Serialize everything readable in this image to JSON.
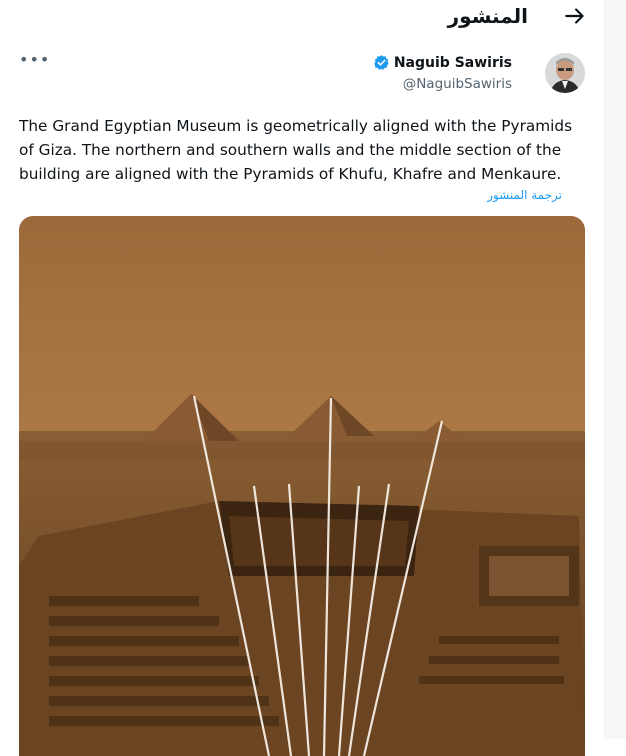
{
  "header": {
    "title": "المنشور"
  },
  "author": {
    "name": "Naguib Sawiris",
    "handle": "@NaguibSawiris"
  },
  "post": {
    "text": "The Grand Egyptian Museum is geometrically aligned with the Pyramids of Giza. The northern and southern walls and the middle section of the building are aligned with the Pyramids of Khufu, Khafre and Menkaure.",
    "translate_label": "ترجمة المنشور"
  },
  "icons": {
    "back": "arrow-icon",
    "verified": "verified-badge-icon",
    "more": "more-icon"
  },
  "colors": {
    "accent": "#1d9bf0",
    "photo_tint": "#a8703a"
  }
}
